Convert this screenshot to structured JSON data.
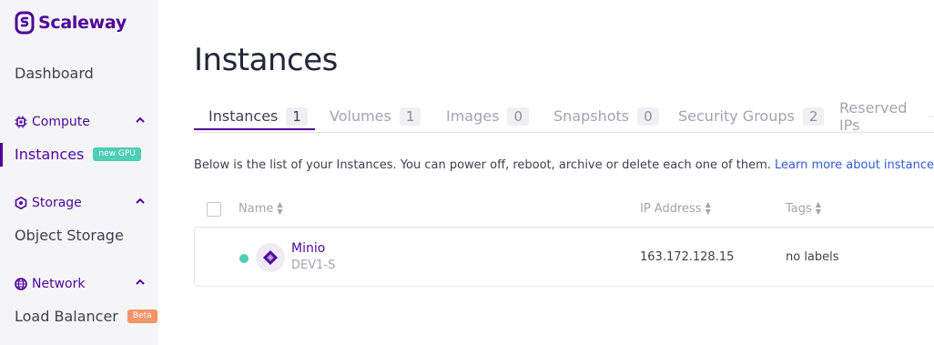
{
  "brand": {
    "name": "Scaleway"
  },
  "sidebar": {
    "dashboard": "Dashboard",
    "sections": [
      {
        "label": "Compute",
        "icon": "chip-icon",
        "items": [
          {
            "label": "Instances",
            "badge": "new GPU"
          }
        ]
      },
      {
        "label": "Storage",
        "icon": "hexagon-icon",
        "items": [
          {
            "label": "Object Storage"
          }
        ]
      },
      {
        "label": "Network",
        "icon": "globe-icon",
        "items": [
          {
            "label": "Load Balancer",
            "badge": "Beta"
          }
        ]
      }
    ]
  },
  "main": {
    "title": "Instances",
    "tabs": [
      {
        "label": "Instances",
        "count": "1"
      },
      {
        "label": "Volumes",
        "count": "1"
      },
      {
        "label": "Images",
        "count": "0"
      },
      {
        "label": "Snapshots",
        "count": "0"
      },
      {
        "label": "Security Groups",
        "count": "2"
      },
      {
        "label": "Reserved IPs",
        "count": ""
      }
    ],
    "description": "Below is the list of your Instances. You can power off, reboot, archive or delete each one of them.",
    "learn_more": "Learn more about instances.",
    "table": {
      "headers": {
        "name": "Name",
        "ip": "IP Address",
        "tags": "Tags"
      },
      "rows": [
        {
          "name": "Minio",
          "type": "DEV1-S",
          "ip": "163.172.128.15",
          "tags": "no labels",
          "status": "running"
        }
      ]
    }
  },
  "colors": {
    "accent": "#4f0599",
    "status_running": "#4ccfb4",
    "badge_beta": "#f59468"
  }
}
